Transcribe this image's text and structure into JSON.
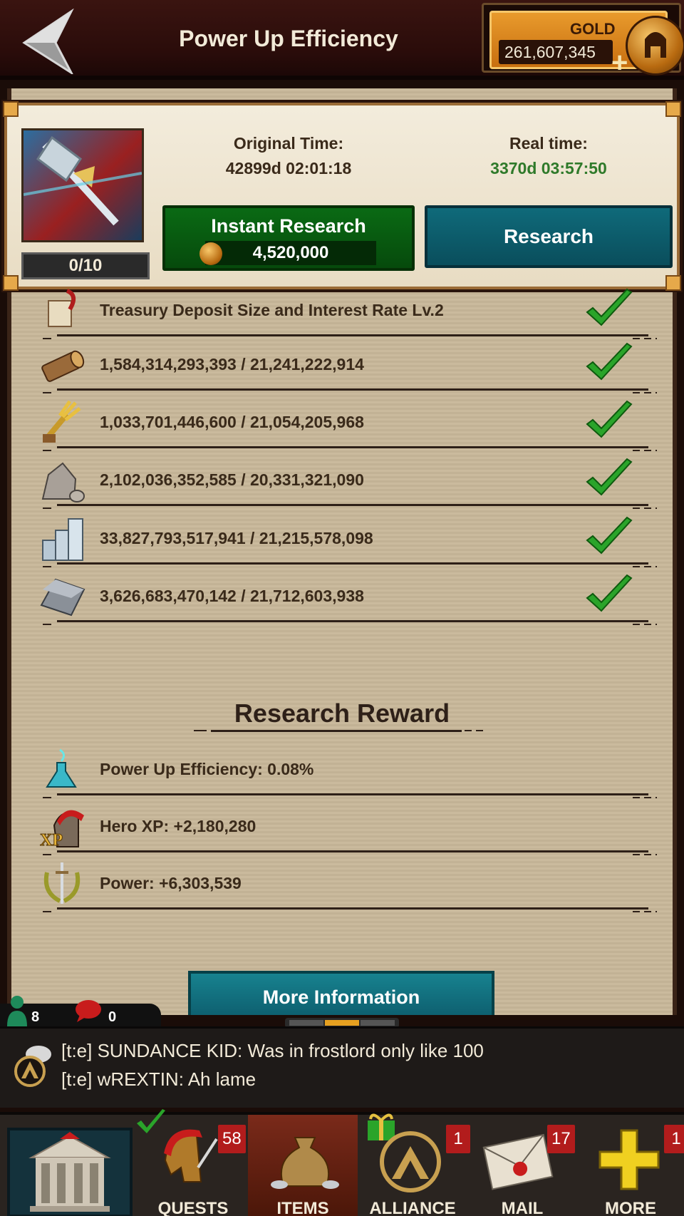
{
  "header": {
    "title": "Power Up Efficiency",
    "gold_label": "GOLD",
    "gold_value": "261,607,345"
  },
  "panel": {
    "level": "0/10",
    "original_time_label": "Original Time:",
    "original_time_value": "42899d 02:01:18",
    "real_time_label": "Real time:",
    "real_time_value": "3370d 03:57:50",
    "instant_label": "Instant Research",
    "instant_cost": "4,520,000",
    "research_label": "Research"
  },
  "requirements": [
    {
      "icon": "scroll-icon",
      "text": "Treasury Deposit Size and Interest Rate Lv.2",
      "met": true
    },
    {
      "icon": "wood-icon",
      "text": "1,584,314,293,393 / 21,241,222,914",
      "met": true
    },
    {
      "icon": "food-icon",
      "text": "1,033,701,446,600 / 21,054,205,968",
      "met": true
    },
    {
      "icon": "stone-icon",
      "text": "2,102,036,352,585 / 20,331,321,090",
      "met": true
    },
    {
      "icon": "silver-icon",
      "text": "33,827,793,517,941 / 21,215,578,098",
      "met": true
    },
    {
      "icon": "iron-icon",
      "text": "3,626,683,470,142 / 21,712,603,938",
      "met": true
    }
  ],
  "reward": {
    "title": "Research Reward",
    "items": [
      {
        "icon": "potion-icon",
        "text": "Power Up Efficiency: 0.08%"
      },
      {
        "icon": "hero-xp-icon",
        "text": "Hero XP: +2,180,280"
      },
      {
        "icon": "power-icon",
        "text": "Power: +6,303,539"
      }
    ]
  },
  "more_info_label": "More Information",
  "counters": {
    "online": "8",
    "messages": "0"
  },
  "chat": {
    "messages": [
      "[t:e] SUNDANCE KID: Was in frostlord only like 100",
      "[t:e] wREXTIN: Ah lame"
    ]
  },
  "nav": {
    "items": [
      {
        "label": "",
        "badge": ""
      },
      {
        "label": "QUESTS",
        "badge": "58"
      },
      {
        "label": "ITEMS",
        "badge": ""
      },
      {
        "label": "ALLIANCE",
        "badge": "1"
      },
      {
        "label": "MAIL",
        "badge": "17"
      },
      {
        "label": "MORE",
        "badge": "1"
      }
    ]
  },
  "colors": {
    "accent_green": "#2f7a2a",
    "research_teal": "#0f6a7a",
    "badge_red": "#b21c1c"
  }
}
